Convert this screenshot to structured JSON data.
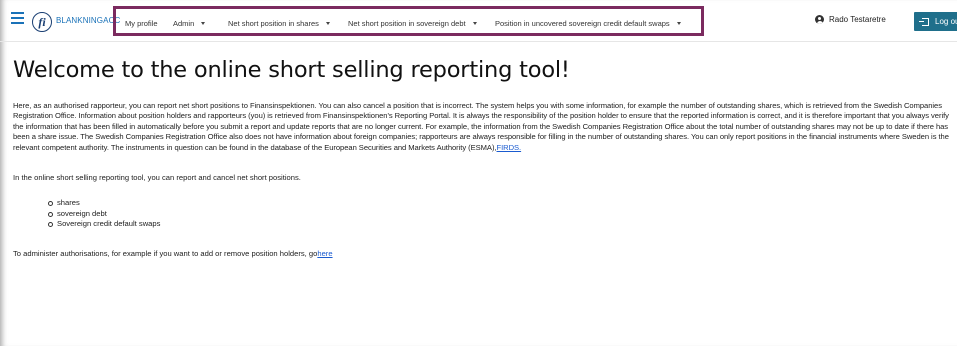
{
  "header": {
    "brand": "BLANKNINGACC",
    "logo_text": "fi",
    "nav": [
      {
        "label": "My profile",
        "has_dropdown": false
      },
      {
        "label": "Admin",
        "has_dropdown": true
      },
      {
        "label": "Net short position in shares",
        "has_dropdown": true
      },
      {
        "label": "Net short position in sovereign debt",
        "has_dropdown": true
      },
      {
        "label": "Position in uncovered sovereign credit default swaps",
        "has_dropdown": true
      }
    ],
    "user_name": "Rado Testaretre",
    "logout_label": "Log out",
    "colors": {
      "accent": "#1a72b8",
      "highlight_border": "#7b2a5f",
      "logout_bg": "#1f6f8b"
    }
  },
  "main": {
    "title": "Welcome to the online short selling reporting tool!",
    "intro_text": "Here, as an authorised rapporteur, you can report net short positions to Finansinspektionen. You can also cancel a position that is incorrect. The system helps you with some information, for example the number of outstanding shares, which is retrieved from the Swedish Companies Registration Office. Information about position holders and rapporteurs (you) is retrieved from Finansinspektionen's Reporting Portal. It is always the responsibility of the position holder to ensure that the reported information is correct, and it is therefore important that you always verify the information that has been filled in automatically before you submit a report and update reports that are no longer current. For example, the information from the Swedish Companies Registration Office about the total number of outstanding shares may not be up to date if there has been a share issue. The Swedish Companies Registration Office also does not have information about foreign companies; rapporteurs are always responsible for filling in the number of outstanding shares. You can only report positions in the financial instruments where Sweden is the relevant competent authority. The instruments in question can be found in the database of the European Securities and Markets Authority (ESMA),",
    "firds_link": "FIRDS.",
    "report_text": "In the online short selling reporting tool, you can report and cancel net short positions.",
    "position_types": [
      "shares",
      "sovereign debt",
      "Sovereign credit default swaps"
    ],
    "admin_text": "To administer authorisations, for example if you want to add or remove position holders, go",
    "admin_link": "here"
  }
}
